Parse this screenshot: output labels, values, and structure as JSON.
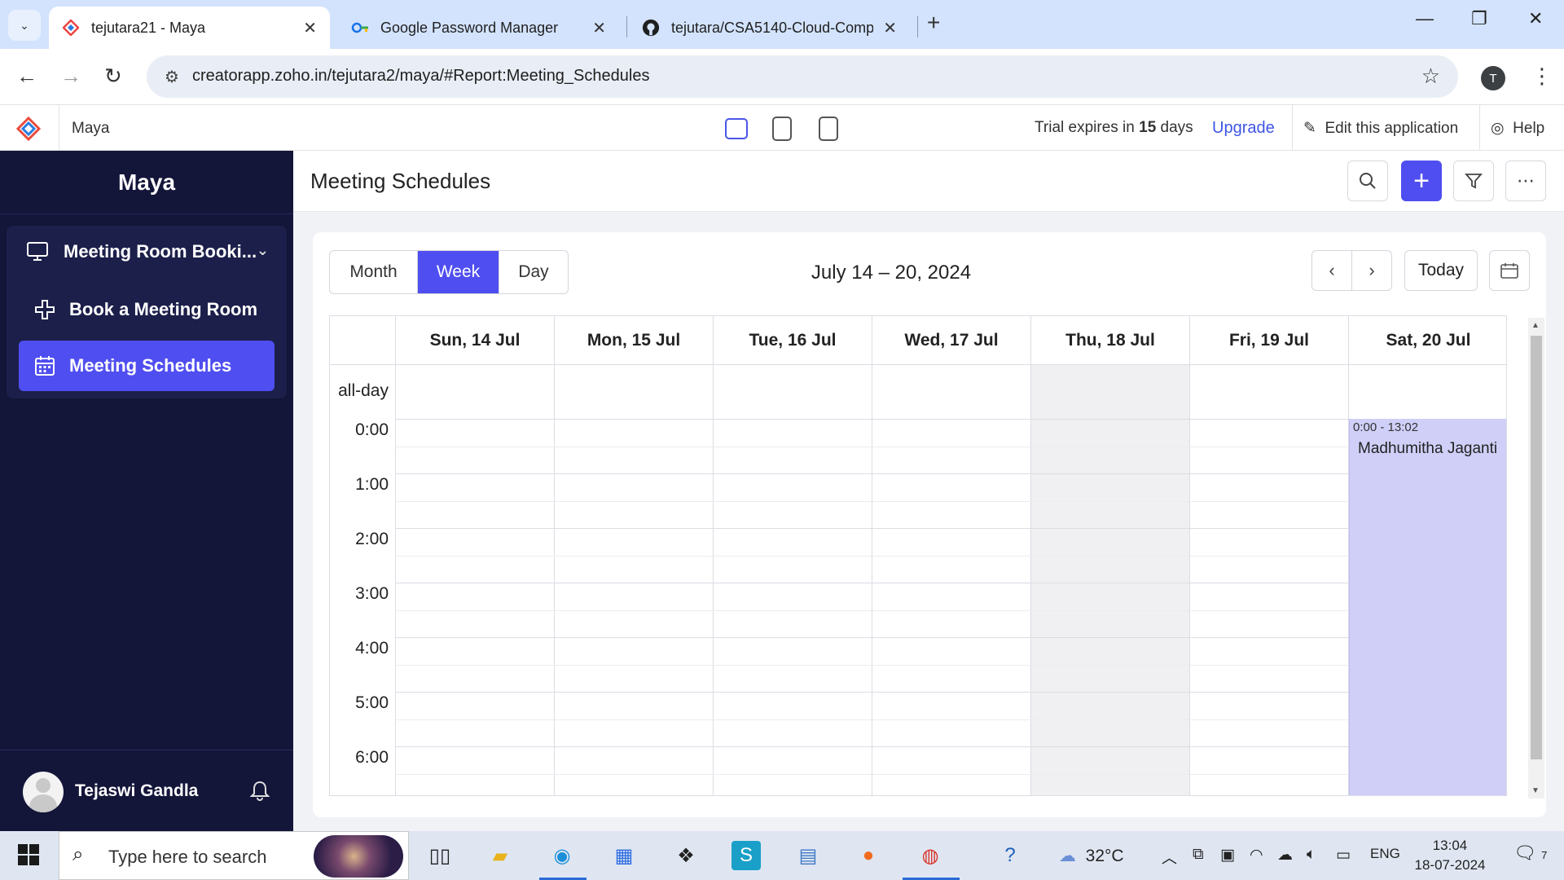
{
  "browser": {
    "tabs": [
      {
        "title": "tejutara21 - Maya",
        "active": true
      },
      {
        "title": "Google Password Manager",
        "active": false
      },
      {
        "title": "tejutara/CSA5140-Cloud-Comp",
        "active": false
      }
    ],
    "new_tab": "+",
    "url": "creatorapp.zoho.in/tejutara2/maya/#Report:Meeting_Schedules",
    "profile_initial": "T"
  },
  "app": {
    "name": "Maya",
    "trial_prefix": "Trial expires in",
    "trial_days": "15",
    "trial_suffix": "days",
    "upgrade": "Upgrade",
    "edit": "Edit this application",
    "help": "Help"
  },
  "sidebar": {
    "title": "Maya",
    "group": "Meeting Room Booki...",
    "items": [
      {
        "label": "Book a Meeting Room",
        "icon": "plus-cross-icon",
        "active": false
      },
      {
        "label": "Meeting Schedules",
        "icon": "calendar-icon",
        "active": true
      }
    ],
    "user": "Tejaswi Gandla"
  },
  "main": {
    "title": "Meeting Schedules",
    "views": [
      "Month",
      "Week",
      "Day"
    ],
    "active_view": "Week",
    "range": "July 14 – 20, 2024",
    "today": "Today"
  },
  "calendar": {
    "days": [
      "Sun, 14 Jul",
      "Mon, 15 Jul",
      "Tue, 16 Jul",
      "Wed, 17 Jul",
      "Thu, 18 Jul",
      "Fri, 19 Jul",
      "Sat, 20 Jul"
    ],
    "today_index": 4,
    "all_day_label": "all-day",
    "hours": [
      "0:00",
      "1:00",
      "2:00",
      "3:00",
      "4:00",
      "5:00",
      "6:00"
    ],
    "events": [
      {
        "day_index": 6,
        "time": "0:00 - 13:02",
        "title": "Madhumitha Jaganti"
      }
    ]
  },
  "taskbar": {
    "search_placeholder": "Type here to search",
    "temperature": "32°C",
    "language": "ENG",
    "time": "13:04",
    "date": "18-07-2024",
    "notification_count": "7"
  },
  "colors": {
    "accent": "#4f4ef0",
    "sidebar_bg": "#131539",
    "event_bg": "#cfcff8",
    "link": "#3e55e4"
  }
}
